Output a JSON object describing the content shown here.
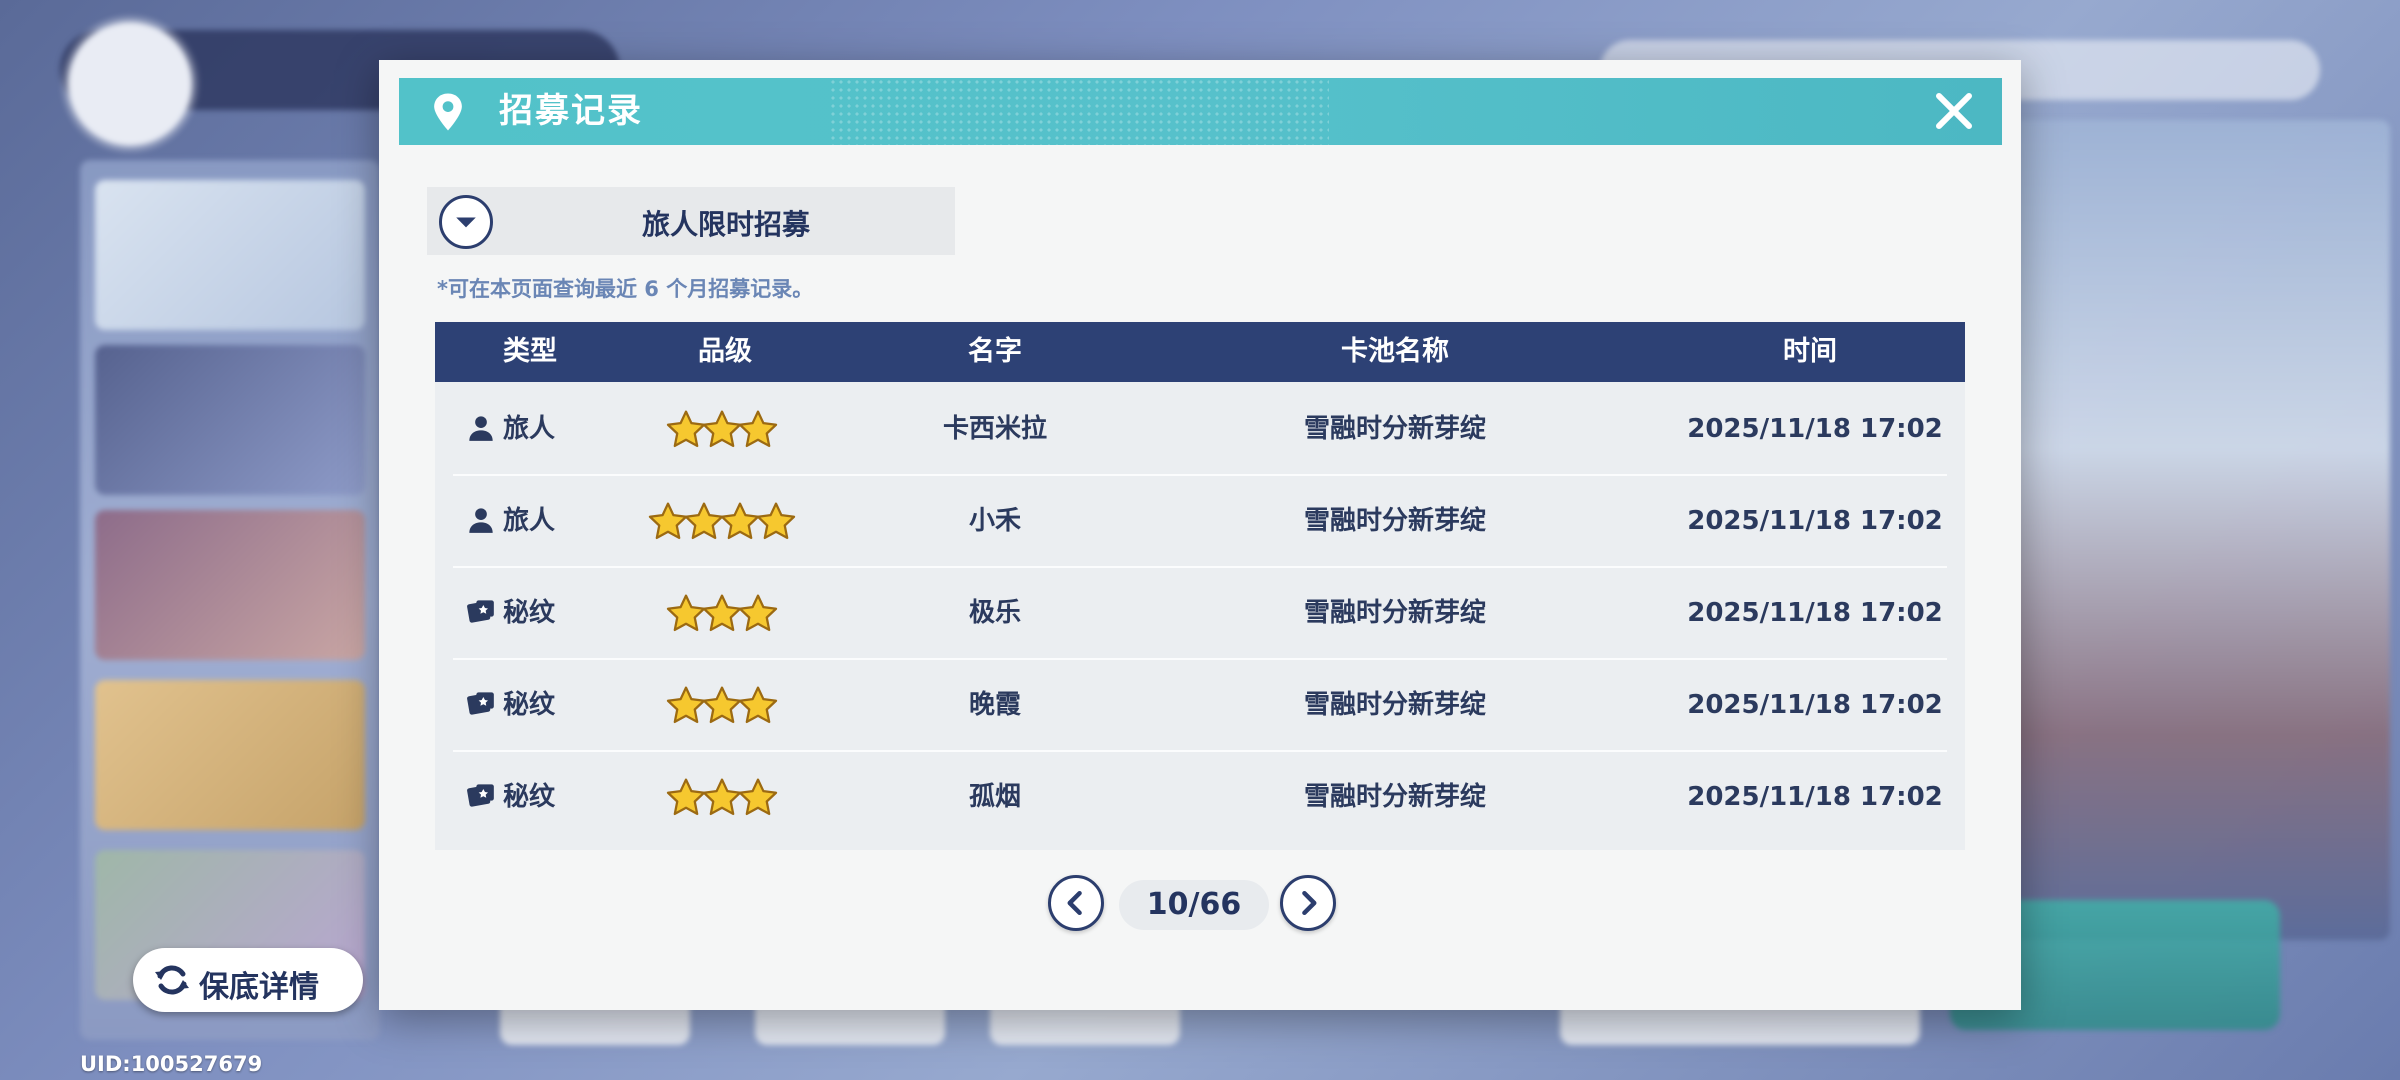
{
  "dialog": {
    "title": "招募记录",
    "close_icon": "close-icon",
    "pin_icon": "location-pin-icon",
    "accent_color": "#52c2c9",
    "header_dark_color": "#2d4175"
  },
  "pool_select": {
    "selected": "旅人限时招募",
    "icon": "chevron-down-icon"
  },
  "hint": "*可在本页面查询最近 6 个月招募记录。",
  "table": {
    "columns": [
      "类型",
      "品级",
      "名字",
      "卡池名称",
      "时间"
    ],
    "rows": [
      {
        "type": "旅人",
        "type_icon": "person-icon",
        "rarity": 3,
        "name": "卡西米拉",
        "pool": "雪融时分新芽绽",
        "time": "2025/11/18 17:02"
      },
      {
        "type": "旅人",
        "type_icon": "person-icon",
        "rarity": 4,
        "name": "小禾",
        "pool": "雪融时分新芽绽",
        "time": "2025/11/18 17:02"
      },
      {
        "type": "秘纹",
        "type_icon": "card-icon",
        "rarity": 3,
        "name": "极乐",
        "pool": "雪融时分新芽绽",
        "time": "2025/11/18 17:02"
      },
      {
        "type": "秘纹",
        "type_icon": "card-icon",
        "rarity": 3,
        "name": "晚霞",
        "pool": "雪融时分新芽绽",
        "time": "2025/11/18 17:02"
      },
      {
        "type": "秘纹",
        "type_icon": "card-icon",
        "rarity": 3,
        "name": "孤烟",
        "pool": "雪融时分新芽绽",
        "time": "2025/11/18 17:02"
      }
    ]
  },
  "pager": {
    "text": "10/66",
    "prev_icon": "chevron-left-icon",
    "next_icon": "chevron-right-icon"
  },
  "guarantee_button": {
    "label": "保底详情",
    "icon": "cycle-icon"
  },
  "uid": "UID:100527679"
}
